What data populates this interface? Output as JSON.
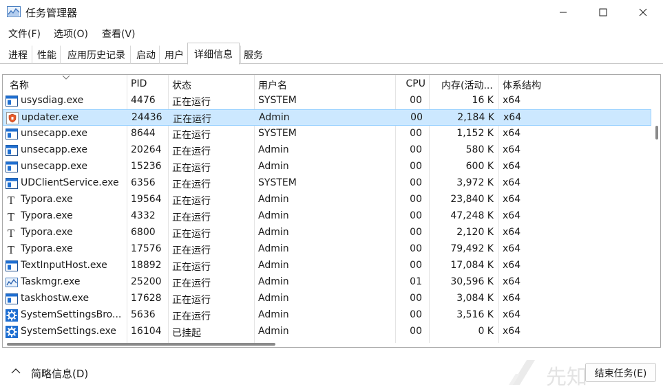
{
  "window": {
    "title": "任务管理器",
    "icon": "taskmgr-icon"
  },
  "menu": [
    "文件(F)",
    "选项(O)",
    "查看(V)"
  ],
  "tabs": [
    {
      "label": "进程",
      "active": false
    },
    {
      "label": "性能",
      "active": false
    },
    {
      "label": "应用历史记录",
      "active": false
    },
    {
      "label": "启动",
      "active": false
    },
    {
      "label": "用户",
      "active": false
    },
    {
      "label": "详细信息",
      "active": true
    },
    {
      "label": "服务",
      "active": false
    }
  ],
  "columns": {
    "name": "名称",
    "pid": "PID",
    "status": "状态",
    "user": "用户名",
    "cpu": "CPU",
    "memory": "内存(活动...",
    "arch": "体系结构"
  },
  "rows": [
    {
      "icon": "window-app-icon",
      "name": "usysdiag.exe",
      "pid": "4476",
      "status": "正在运行",
      "user": "SYSTEM",
      "cpu": "00",
      "memory": "16 K",
      "arch": "x64",
      "selected": false
    },
    {
      "icon": "shield-app-icon",
      "name": "updater.exe",
      "pid": "24436",
      "status": "正在运行",
      "user": "Admin",
      "cpu": "00",
      "memory": "2,184 K",
      "arch": "x64",
      "selected": true
    },
    {
      "icon": "window-app-icon",
      "name": "unsecapp.exe",
      "pid": "8644",
      "status": "正在运行",
      "user": "SYSTEM",
      "cpu": "00",
      "memory": "1,152 K",
      "arch": "x64",
      "selected": false
    },
    {
      "icon": "window-app-icon",
      "name": "unsecapp.exe",
      "pid": "20264",
      "status": "正在运行",
      "user": "Admin",
      "cpu": "00",
      "memory": "580 K",
      "arch": "x64",
      "selected": false
    },
    {
      "icon": "window-app-icon",
      "name": "unsecapp.exe",
      "pid": "15236",
      "status": "正在运行",
      "user": "Admin",
      "cpu": "00",
      "memory": "600 K",
      "arch": "x64",
      "selected": false
    },
    {
      "icon": "window-app-icon",
      "name": "UDClientService.exe",
      "pid": "6356",
      "status": "正在运行",
      "user": "SYSTEM",
      "cpu": "00",
      "memory": "3,972 K",
      "arch": "x64",
      "selected": false
    },
    {
      "icon": "typora-icon",
      "name": "Typora.exe",
      "pid": "19564",
      "status": "正在运行",
      "user": "Admin",
      "cpu": "00",
      "memory": "23,840 K",
      "arch": "x64",
      "selected": false
    },
    {
      "icon": "typora-icon",
      "name": "Typora.exe",
      "pid": "4332",
      "status": "正在运行",
      "user": "Admin",
      "cpu": "00",
      "memory": "47,248 K",
      "arch": "x64",
      "selected": false
    },
    {
      "icon": "typora-icon",
      "name": "Typora.exe",
      "pid": "6800",
      "status": "正在运行",
      "user": "Admin",
      "cpu": "00",
      "memory": "2,120 K",
      "arch": "x64",
      "selected": false
    },
    {
      "icon": "typora-icon",
      "name": "Typora.exe",
      "pid": "17576",
      "status": "正在运行",
      "user": "Admin",
      "cpu": "00",
      "memory": "79,492 K",
      "arch": "x64",
      "selected": false
    },
    {
      "icon": "window-app-icon",
      "name": "TextInputHost.exe",
      "pid": "18892",
      "status": "正在运行",
      "user": "Admin",
      "cpu": "00",
      "memory": "17,084 K",
      "arch": "x64",
      "selected": false
    },
    {
      "icon": "taskmgr-icon",
      "name": "Taskmgr.exe",
      "pid": "25200",
      "status": "正在运行",
      "user": "Admin",
      "cpu": "01",
      "memory": "30,596 K",
      "arch": "x64",
      "selected": false
    },
    {
      "icon": "window-app-icon",
      "name": "taskhostw.exe",
      "pid": "17628",
      "status": "正在运行",
      "user": "Admin",
      "cpu": "00",
      "memory": "3,084 K",
      "arch": "x64",
      "selected": false
    },
    {
      "icon": "gear-icon",
      "name": "SystemSettingsBro...",
      "pid": "5636",
      "status": "正在运行",
      "user": "Admin",
      "cpu": "00",
      "memory": "3,516 K",
      "arch": "x64",
      "selected": false
    },
    {
      "icon": "gear-icon",
      "name": "SystemSettings.exe",
      "pid": "16104",
      "status": "已挂起",
      "user": "Admin",
      "cpu": "00",
      "memory": "0 K",
      "arch": "x64",
      "selected": false
    }
  ],
  "footer": {
    "brief_label": "简略信息(D)",
    "end_task_label": "结束任务(E)",
    "watermark_text": "先知"
  },
  "colors": {
    "selected_bg": "#cce8ff",
    "selected_border": "#99d1ff",
    "icon_blue": "#1f6fd1"
  }
}
